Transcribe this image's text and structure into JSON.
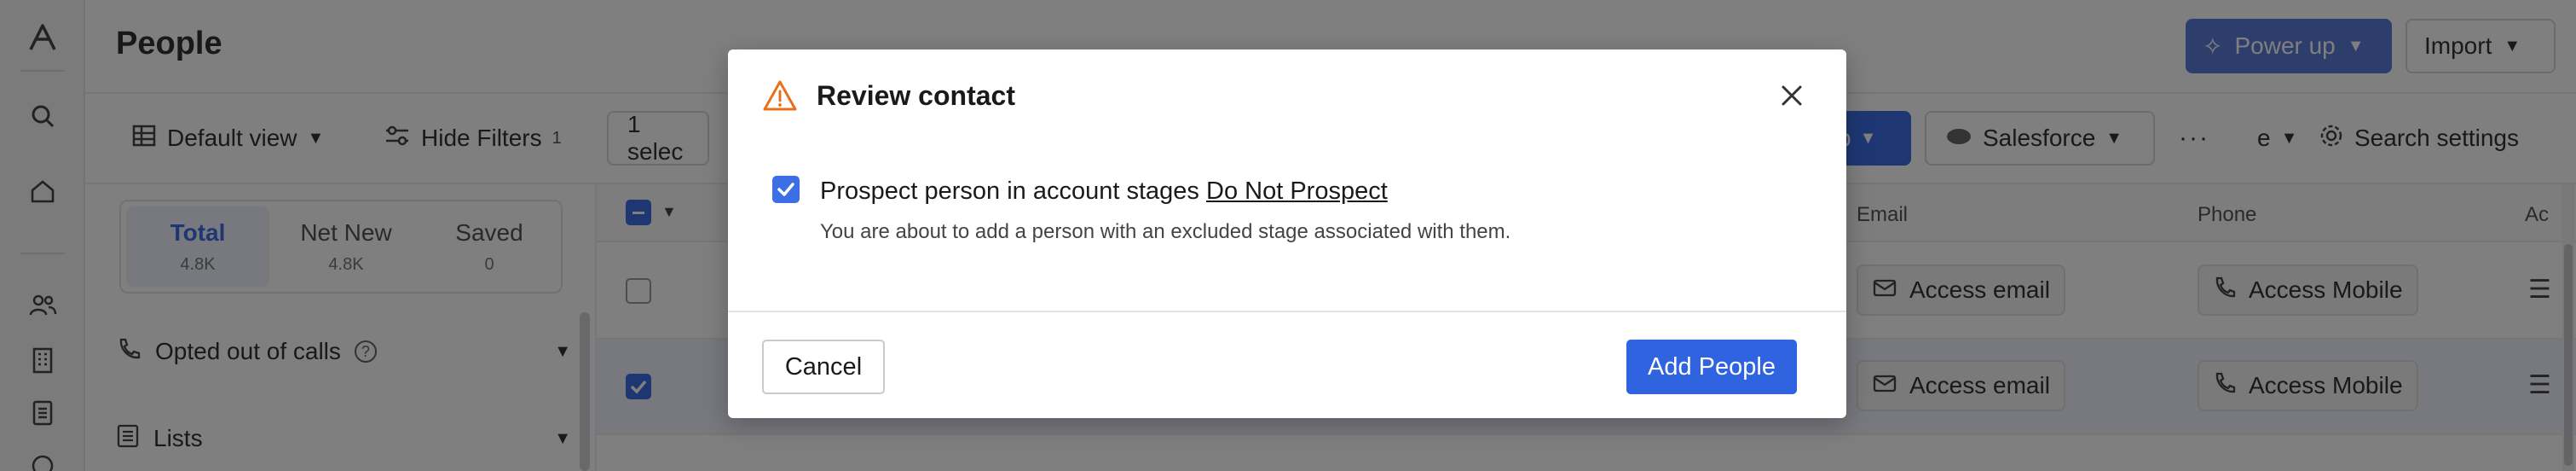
{
  "app": {
    "page_title": "People",
    "header": {
      "power_up_label": "Power up",
      "import_label": "Import"
    },
    "toolbar": {
      "view_label": "Default view",
      "hide_filters_label": "Hide Filters",
      "filter_count": "1",
      "selection_text": "1 selec",
      "blue_button_partial": "p",
      "salesforce_label": "Salesforce",
      "partial_label": "e",
      "search_settings_label": "Search settings"
    },
    "stats": [
      {
        "label": "Total",
        "value": "4.8K"
      },
      {
        "label": "Net New",
        "value": "4.8K"
      },
      {
        "label": "Saved",
        "value": "0"
      }
    ],
    "filters": [
      {
        "label": "Opted out of calls"
      },
      {
        "label": "Lists"
      }
    ],
    "table": {
      "columns": {
        "email": "Email",
        "phone": "Phone",
        "actions": "Ac"
      },
      "rows": [
        {
          "email": "Access email",
          "phone": "Access Mobile"
        },
        {
          "email": "Access email",
          "phone": "Access Mobile"
        }
      ]
    }
  },
  "modal": {
    "title": "Review contact",
    "checkbox_label": "Prospect person in account stages",
    "stage_link": "Do Not Prospect",
    "description": "You are about to add a person with an excluded stage associated with them.",
    "cancel_label": "Cancel",
    "confirm_label": "Add People",
    "colors": {
      "primary": "#2f63e0",
      "warning": "#e8701a"
    }
  }
}
